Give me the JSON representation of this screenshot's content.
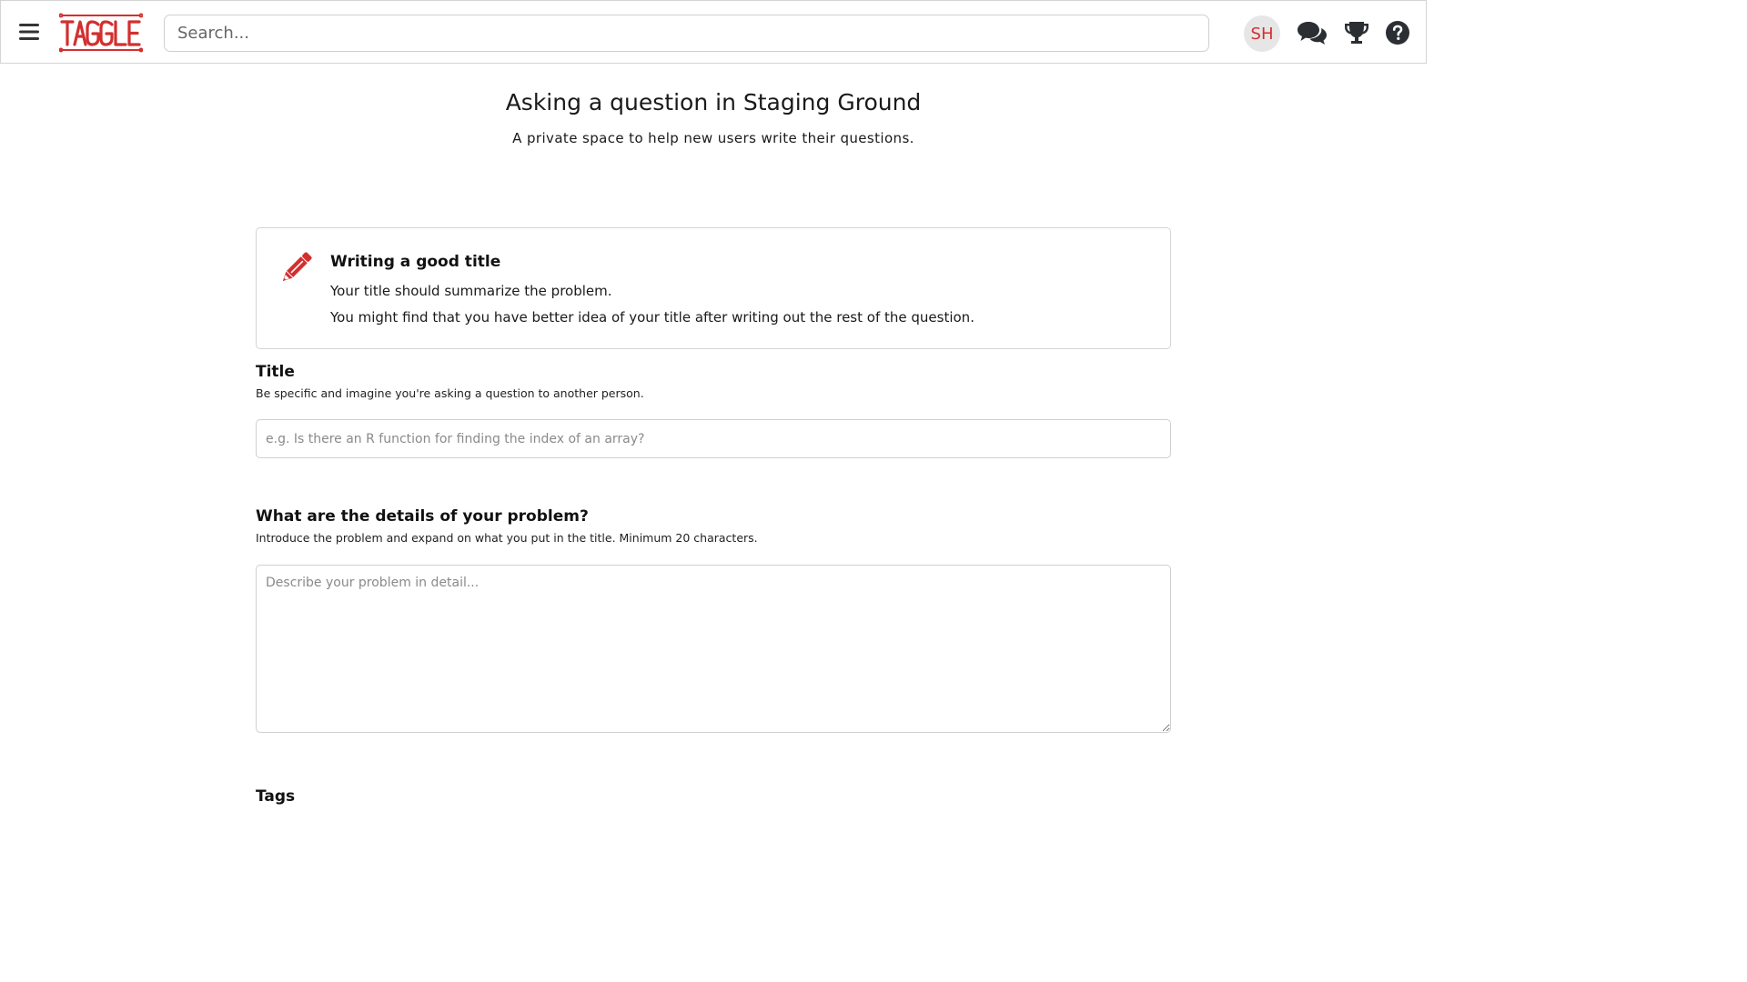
{
  "header": {
    "logo_text": "TAGGLE",
    "search_placeholder": "Search...",
    "avatar_initials": "SH",
    "brand_color": "#d32f2f",
    "icons": [
      "hamburger-menu-icon",
      "chat-icon",
      "trophy-icon",
      "help-icon"
    ]
  },
  "page": {
    "title": "Asking a question in Staging Ground",
    "subtitle": "A private space to help new users write their questions."
  },
  "tip": {
    "icon": "pencil-icon",
    "heading": "Writing a good title",
    "line1": "Your title should summarize the problem.",
    "line2": "You might find that you have better idea of your title after writing out the rest of the question."
  },
  "title_section": {
    "label": "Title",
    "help": "Be specific and imagine you're asking a question to another person.",
    "placeholder": "e.g. Is there an R function for finding the index of an array?",
    "value": ""
  },
  "details_section": {
    "label": "What are the details of your problem?",
    "help": "Introduce the problem and expand on what you put in the title. Minimum 20 characters.",
    "placeholder": "Describe your problem in detail...",
    "value": ""
  },
  "tags_section": {
    "label": "Tags"
  }
}
